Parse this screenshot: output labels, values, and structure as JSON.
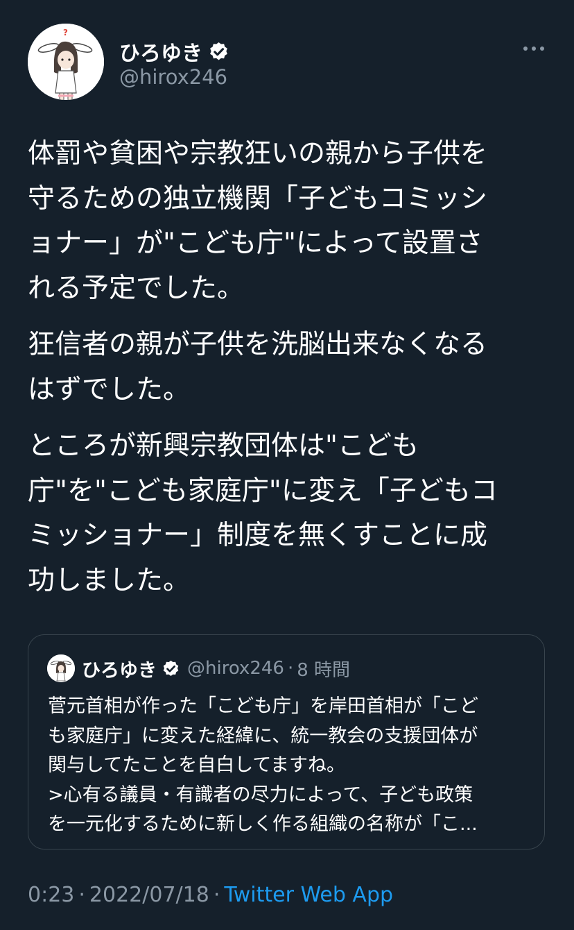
{
  "tweet": {
    "author": {
      "display_name": "ひろゆき",
      "handle": "@hirox246",
      "avatar_icon": "avatar-bunny-girl",
      "verified_icon": "verified-badge-icon"
    },
    "more_icon": "more-options-icon",
    "paragraphs": [
      [
        "体罰や貧困や宗教狂いの親から子供を",
        "守るための独立機関「子どもコミッシ",
        "ョナー」が\"こども庁\"によって設置さ",
        "れる予定でした。"
      ],
      [
        "狂信者の親が子供を洗脳出来なくなる",
        "はずでした。"
      ],
      [
        "ところが新興宗教団体は\"こども",
        "庁\"を\"こども家庭庁\"に変え「子どもコ",
        "ミッショナー」制度を無くすことに成",
        "功しました。"
      ]
    ],
    "quoted": {
      "display_name": "ひろゆき",
      "handle": "@hirox246",
      "separator": "·",
      "time": "8 時間",
      "lines": [
        "菅元首相が作った「こども庁」を岸田首相が「こど",
        "も家庭庁」に変えた経緯に、統一教会の支援団体が",
        "関与してたことを自白してますね。",
        ">心有る議員・有識者の尽力によって、子ども政策",
        "を一元化するために新しく作る組織の名称が「こ..."
      ]
    },
    "meta": {
      "time": "0:23",
      "separator": "·",
      "date": "2022/07/18",
      "source": "Twitter Web App"
    }
  },
  "colors": {
    "background": "#15202b",
    "text_primary": "#ffffff",
    "text_secondary": "#8b98a5",
    "accent": "#1d9bf0",
    "border": "#38444d"
  }
}
